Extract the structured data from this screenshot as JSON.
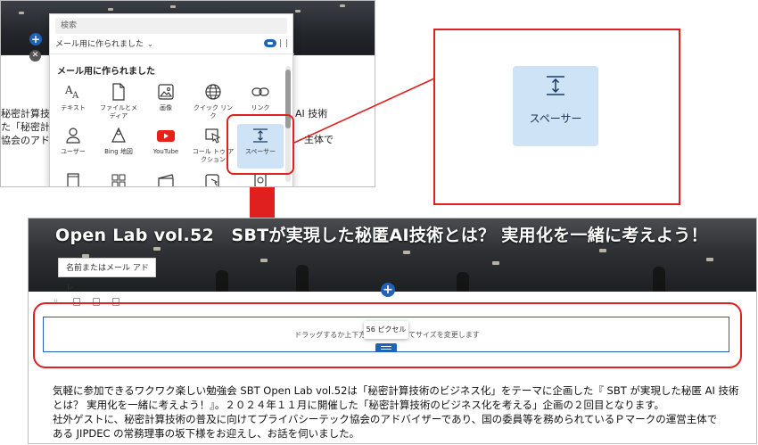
{
  "panel": {
    "search_placeholder": "検索",
    "filter_label": "メール用に作られました",
    "section_heading": "メール用に作られました",
    "tiles": [
      {
        "label": "テキスト",
        "icon": "text-size-icon"
      },
      {
        "label": "ファイルとメ\nディア",
        "icon": "file-media-icon"
      },
      {
        "label": "画像",
        "icon": "image-icon"
      },
      {
        "label": "クイック リン\nク",
        "icon": "globe-icon"
      },
      {
        "label": "リンク",
        "icon": "link-icon"
      },
      {
        "label": "ユーザー",
        "icon": "user-icon"
      },
      {
        "label": "Bing 地図",
        "icon": "map-pin-icon"
      },
      {
        "label": "YouTube",
        "icon": "youtube-icon"
      },
      {
        "label": "コール トゥ ア\nクション",
        "icon": "call-to-action-icon"
      },
      {
        "label": "スペーサー",
        "icon": "spacer-icon"
      }
    ]
  },
  "top_left_bg_text": {
    "line1_left": "秘密計算技",
    "line1_right": "AI 技術",
    "line2_left": "た「秘密計",
    "line2_right": "主体で",
    "line3_left": "協会のアド"
  },
  "callout": {
    "label": "スペーサー",
    "icon": "spacer-icon"
  },
  "bottom": {
    "title": "Open Lab vol.52　SBTが実現した秘匿AI技術とは？ 実用化を一緒に考えよう！",
    "author_placeholder": "名前またはメール アドレ",
    "spacer_message": "ドラッグするか上下方向キーを押してサイズを変更します",
    "pixel_tooltip": "56 ピクセル",
    "body_lines": [
      "気軽に参加できるワクワク楽しい勉強会 SBT Open Lab vol.52は「秘密計算技術のビジネス化」をテーマに企画した『 SBT が実現した秘匿 AI 技術",
      "とは？ 実用化を一緒に考えよう！』。２０２４年１１月に開催した「秘密計算技術のビジネス化を考える」企画の２回目となります。",
      "社外ゲストに、秘密計算技術の普及に向けてプライバシーテック協会のアドバイザーであり、国の委員等を務められているＰマークの運営主体で",
      "ある JIPDEC の常務理事の坂下様をお迎えし、お話を伺いました。"
    ]
  },
  "colors": {
    "accent": "#1f62b8",
    "highlight": "#e0201f",
    "tile_selected": "#cfe3f7"
  }
}
